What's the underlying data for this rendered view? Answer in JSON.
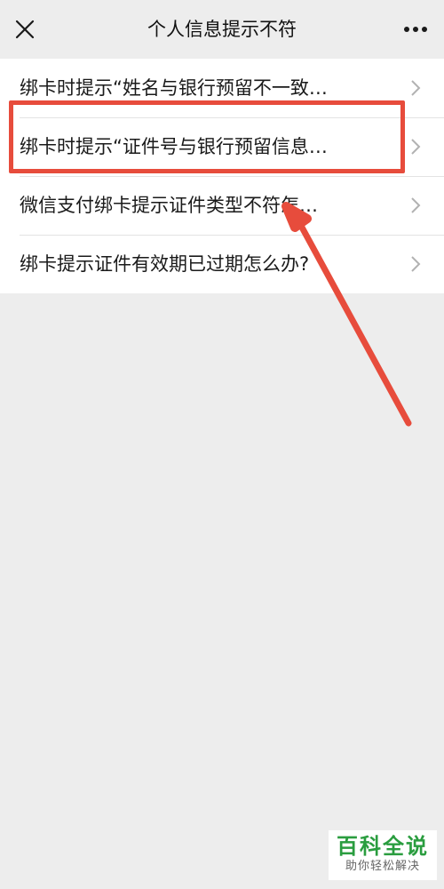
{
  "header": {
    "title": "个人信息提示不符",
    "close_icon": "close-icon",
    "more_icon": "more-dots-icon"
  },
  "list": {
    "items": [
      {
        "label": "绑卡时提示“姓名与银行预留不一致…"
      },
      {
        "label": "绑卡时提示“证件号与银行预留信息…"
      },
      {
        "label": "微信支付绑卡提示证件类型不符怎…"
      },
      {
        "label": "绑卡提示证件有效期已过期怎么办?"
      }
    ],
    "chevron_icon": "chevron-right-icon"
  },
  "annotation": {
    "highlight_color": "#e74c3c",
    "arrow_color": "#e74c3c"
  },
  "watermark": {
    "title": "百科全说",
    "subtitle": "助你轻松解决",
    "color": "#2a9d3f"
  }
}
